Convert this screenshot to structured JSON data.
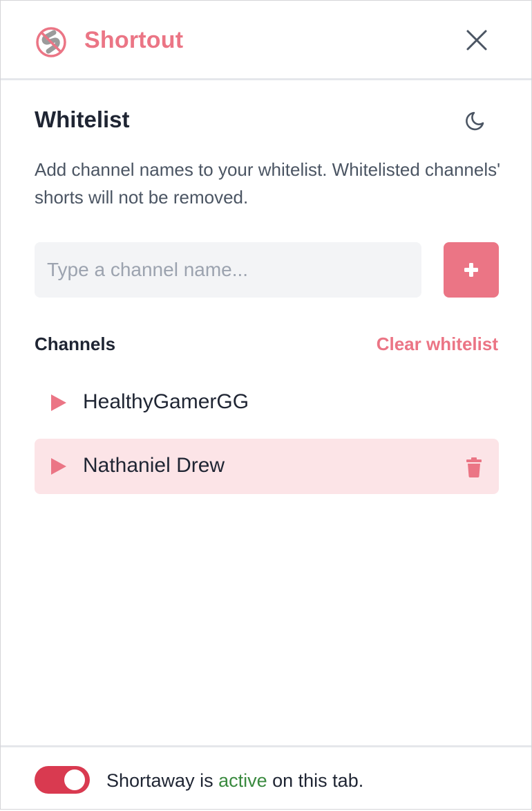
{
  "header": {
    "app_name": "Shortout",
    "close_icon": "close-icon",
    "logo_icon": "no-shorts-logo-icon"
  },
  "whitelist": {
    "title": "Whitelist",
    "theme_icon": "moon-icon",
    "description": "Add channel names to your whitelist. Whitelisted channels' shorts will not be removed.",
    "input_placeholder": "Type a channel name...",
    "input_value": "",
    "add_icon": "plus-icon"
  },
  "channels": {
    "heading": "Channels",
    "clear_label": "Clear whitelist",
    "items": [
      {
        "label": "HealthyGamerGG",
        "hovered": false
      },
      {
        "label": "Nathaniel Drew",
        "hovered": true
      }
    ]
  },
  "footer": {
    "toggle_on": true,
    "status_prefix": "Shortaway is ",
    "status_keyword": "active",
    "status_suffix": " on this tab."
  },
  "colors": {
    "accent": "#eb7585",
    "toggle": "#d93a50",
    "hover_row": "#fce4e7",
    "active_text": "#3a8a3f"
  }
}
